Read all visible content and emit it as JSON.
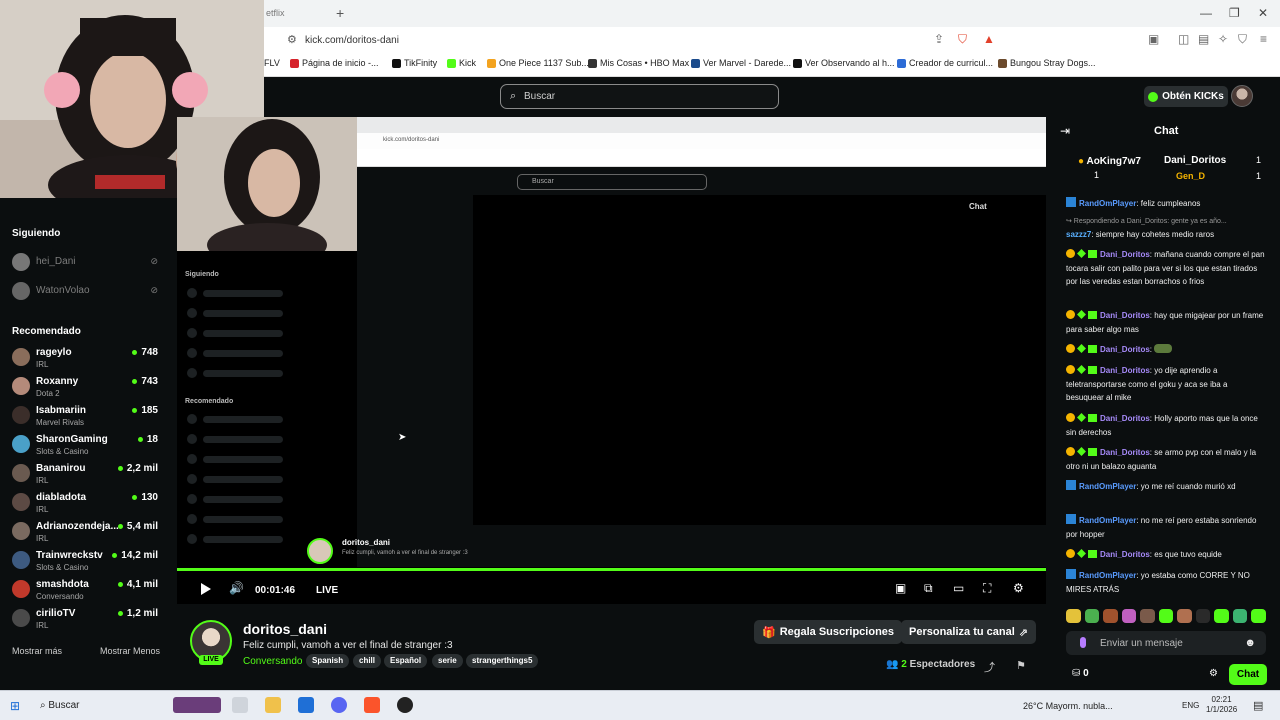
{
  "browser": {
    "tab_title": "etflix",
    "address": "kick.com/doritos-dani",
    "bookmarks": [
      "FLV",
      "Página de inicio -...",
      "TikFinity",
      "Kick",
      "One Piece 1137 Sub...",
      "Mis Cosas • HBO Max",
      "Ver Marvel - Darede...",
      "Ver Observando al h...",
      "Creador de curricul...",
      "Bungou Stray Dogs..."
    ]
  },
  "header": {
    "search_placeholder": "Buscar",
    "kicks_label": "Obtén KICKs"
  },
  "sidebar": {
    "following_title": "Siguiendo",
    "following": [
      {
        "name": "hei_Dani"
      },
      {
        "name": "WatonVolao"
      }
    ],
    "recommended_title": "Recomendado",
    "recommended": [
      {
        "name": "rageylo",
        "category": "IRL",
        "viewers": "748"
      },
      {
        "name": "Roxanny",
        "category": "Dota 2",
        "viewers": "743"
      },
      {
        "name": "Isabmariin",
        "category": "Marvel Rivals",
        "viewers": "185"
      },
      {
        "name": "SharonGaming",
        "category": "Slots & Casino",
        "viewers": "18"
      },
      {
        "name": "Bananirou",
        "category": "IRL",
        "viewers": "2,2 mil"
      },
      {
        "name": "diabladota",
        "category": "IRL",
        "viewers": "130"
      },
      {
        "name": "Adrianozendeja...",
        "category": "IRL",
        "viewers": "5,4 mil"
      },
      {
        "name": "Trainwreckstv",
        "category": "Slots & Casino",
        "viewers": "14,2 mil"
      },
      {
        "name": "smashdota",
        "category": "Conversando",
        "viewers": "4,1 mil"
      },
      {
        "name": "cirilioTV",
        "category": "IRL",
        "viewers": "1,2 mil"
      }
    ],
    "show_more": "Mostrar más",
    "show_less": "Mostrar Menos"
  },
  "player": {
    "time": "00:01:46",
    "live_label": "LIVE",
    "progress": 1.0,
    "inner": {
      "address": "kick.com/doritos-dani",
      "search": "Buscar",
      "following": "Siguiendo",
      "recommended": "Recomendado",
      "chat": "Chat",
      "streamer": "doritos_dani",
      "title": "Feliz cumpli, vamoh a ver el final de stranger :3"
    }
  },
  "stream": {
    "streamer": "doritos_dani",
    "live_badge": "LIVE",
    "title": "Feliz cumpli, vamoh a ver el final de stranger :3",
    "category": "Conversando",
    "tags": [
      "Spanish",
      "chill",
      "Español",
      "serie",
      "strangerthings5"
    ],
    "gift_button": "Regala Suscripciones",
    "customize_button": "Personaliza tu canal",
    "viewers_count": "2",
    "viewers_label": "Espectadores"
  },
  "chat": {
    "title": "Chat",
    "leaderboard": [
      {
        "name": "AoKing7w7",
        "count": "1"
      },
      {
        "name": "Dani_Doritos",
        "count": "1"
      },
      {
        "name": "Gen_D",
        "count": "1"
      }
    ],
    "messages": [
      {
        "user": "RandOmPlayer",
        "text": ": feliz cumpleanos",
        "kind": "blue"
      },
      {
        "user": "",
        "text": "↪ Respondiendo a Dani_Doritos: gente ya es año...",
        "kind": "reply"
      },
      {
        "user": "sazzz7",
        "text": ": siempre hay cohetes medio raros",
        "kind": "plain"
      },
      {
        "user": "Dani_Doritos",
        "text": ": mañana cuando compre el pan tocara salir con palito para ver si los que estan tirados por las veredas estan borrachos o frios",
        "kind": "mod"
      },
      {
        "user": "Dani_Doritos",
        "text": ": hay que migajear por un frame para saber algo mas",
        "kind": "mod"
      },
      {
        "user": "Dani_Doritos",
        "text": ":",
        "kind": "mod"
      },
      {
        "user": "Dani_Doritos",
        "text": ": yo dije aprendio a teletransportarse como el goku y aca se iba a besuquear al mike",
        "kind": "mod"
      },
      {
        "user": "Dani_Doritos",
        "text": ": Holly aporto mas que la once sin derechos",
        "kind": "mod"
      },
      {
        "user": "Dani_Doritos",
        "text": ": se armo pvp con el malo y la otro ni un balazo aguanta",
        "kind": "mod"
      },
      {
        "user": "RandOmPlayer",
        "text": ": yo me reí cuando murió xd",
        "kind": "blue"
      },
      {
        "user": "RandOmPlayer",
        "text": ": no me reí pero estaba sonriendo por hopper",
        "kind": "blue"
      },
      {
        "user": "Dani_Doritos",
        "text": ": es que tuvo equide",
        "kind": "mod"
      },
      {
        "user": "RandOmPlayer",
        "text": ": yo estaba como CORRE Y NO MIRES ATRÁS",
        "kind": "blue"
      }
    ],
    "input_placeholder": "Enviar un mensaje",
    "points": "0",
    "send_label": "Chat"
  },
  "taskbar": {
    "search_label": "Buscar",
    "weather": "26°C  Mayorm. nubla...",
    "lang": "ENG",
    "time": "02:21",
    "date": "1/1/2026"
  },
  "colors": {
    "accent": "#53fc18",
    "bg": "#0b0e0f",
    "panel": "#2a2f31"
  }
}
